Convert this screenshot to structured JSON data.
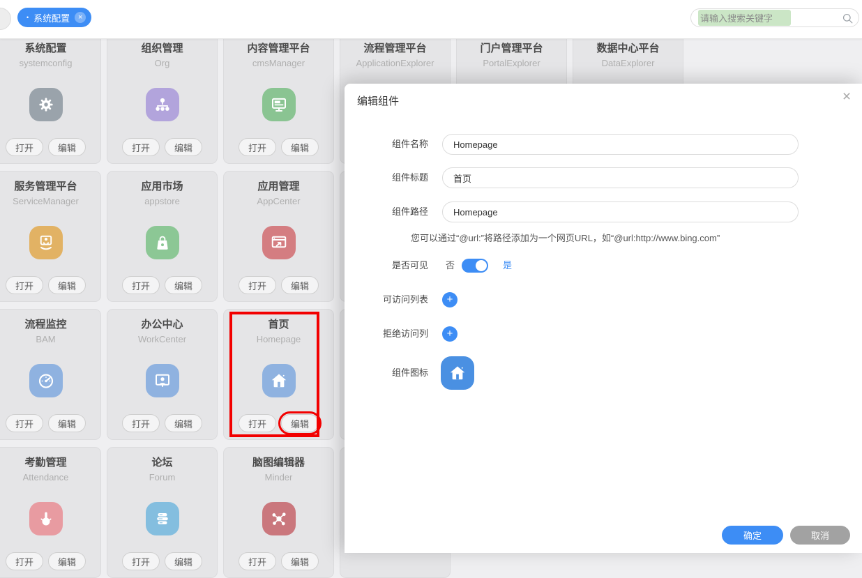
{
  "colors": {
    "accent": "#3d8df5",
    "highlight_red": "#f20000",
    "modal_icon_blue": "#4a90e2"
  },
  "header": {
    "tab": {
      "dot": "•",
      "label": "系统配置",
      "close_icon": "close-circle-icon"
    },
    "search": {
      "placeholder": "请输入搜索关键字",
      "icon": "search-icon"
    }
  },
  "grid": {
    "open_label": "打开",
    "edit_label": "编辑",
    "cards": [
      {
        "row": 1,
        "col": 1,
        "title": "系统配置",
        "subtitle": "systemconfig",
        "icon": "gear-icon",
        "icon_color": "#9aa3ab"
      },
      {
        "row": 1,
        "col": 2,
        "title": "组织管理",
        "subtitle": "Org",
        "icon": "org-chart-icon",
        "icon_color": "#b2a4dc"
      },
      {
        "row": 1,
        "col": 3,
        "title": "内容管理平台",
        "subtitle": "cmsManager",
        "icon": "monitor-icon",
        "icon_color": "#8ac492"
      },
      {
        "row": 1,
        "col": 4,
        "title": "流程管理平台",
        "subtitle": "ApplicationExplorer",
        "icon": null,
        "icon_color": null
      },
      {
        "row": 1,
        "col": 5,
        "title": "门户管理平台",
        "subtitle": "PortalExplorer",
        "icon": null,
        "icon_color": null
      },
      {
        "row": 1,
        "col": 6,
        "title": "数据中心平台",
        "subtitle": "DataExplorer",
        "icon": null,
        "icon_color": null
      },
      {
        "row": 2,
        "col": 1,
        "title": "服务管理平台",
        "subtitle": "ServiceManager",
        "icon": "service-desk-icon",
        "icon_color": "#e2b264"
      },
      {
        "row": 2,
        "col": 2,
        "title": "应用市场",
        "subtitle": "appstore",
        "icon": "shopping-bag-icon",
        "icon_color": "#8cc795"
      },
      {
        "row": 2,
        "col": 3,
        "title": "应用管理",
        "subtitle": "AppCenter",
        "icon": "window-share-icon",
        "icon_color": "#d47d81"
      },
      {
        "row": 2,
        "col": 4,
        "stub": true
      },
      {
        "row": 3,
        "col": 1,
        "title": "流程监控",
        "subtitle": "BAM",
        "icon": "gauge-icon",
        "icon_color": "#8fb2e0"
      },
      {
        "row": 3,
        "col": 2,
        "title": "办公中心",
        "subtitle": "WorkCenter",
        "icon": "person-monitor-icon",
        "icon_color": "#8fb2e0"
      },
      {
        "row": 3,
        "col": 3,
        "title": "首页",
        "subtitle": "Homepage",
        "icon": "home-icon",
        "icon_color": "#8fb2e0",
        "highlighted": true
      },
      {
        "row": 3,
        "col": 4,
        "stub": true
      },
      {
        "row": 4,
        "col": 1,
        "title": "考勤管理",
        "subtitle": "Attendance",
        "icon": "hand-pointer-icon",
        "icon_color": "#e89ba1"
      },
      {
        "row": 4,
        "col": 2,
        "title": "论坛",
        "subtitle": "Forum",
        "icon": "list-bars-icon",
        "icon_color": "#84bedf"
      },
      {
        "row": 4,
        "col": 3,
        "title": "脑图编辑器",
        "subtitle": "Minder",
        "icon": "mindmap-icon",
        "icon_color": "#ca777d"
      },
      {
        "row": 4,
        "col": 4,
        "stub": true
      }
    ]
  },
  "modal": {
    "title": "编辑组件",
    "close_icon": "close-icon",
    "fields": {
      "name": {
        "label": "组件名称",
        "value": "Homepage"
      },
      "component_title": {
        "label": "组件标题",
        "value": "首页"
      },
      "path": {
        "label": "组件路径",
        "value": "Homepage"
      },
      "path_hint": "您可以通过“@url:”将路径添加为一个网页URL，如“@url:http://www.bing.com”",
      "visible": {
        "label": "是否可见",
        "off_label": "否",
        "on_label": "是",
        "state": "on"
      },
      "access_list": {
        "label": "可访问列表",
        "add_label": "+"
      },
      "deny_list": {
        "label": "拒绝访问列",
        "add_label": "+"
      },
      "icon_field": {
        "label": "组件图标",
        "icon": "home-icon",
        "icon_color": "#4a90e2"
      }
    },
    "footer": {
      "ok_label": "确定",
      "cancel_label": "取消"
    }
  }
}
